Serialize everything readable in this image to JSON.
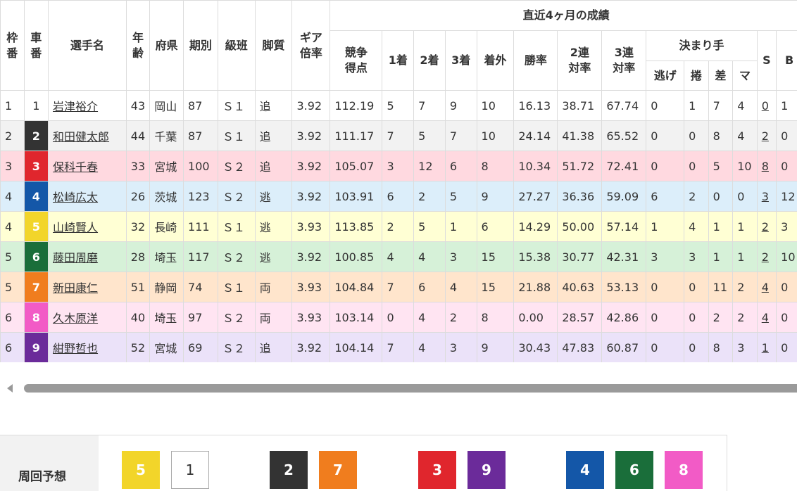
{
  "table": {
    "group_header": "直近4ヶ月の成績",
    "headers": {
      "waku": "枠\n番",
      "car": "車\n番",
      "name": "選手名",
      "age": "年\n齢",
      "pref": "府県",
      "term": "期別",
      "class": "級班",
      "style": "脚質",
      "gear": "ギア\n倍率",
      "score": "競争\n得点",
      "first": "1着",
      "second": "2着",
      "third": "3着",
      "out": "着外",
      "win_rate": "勝率",
      "rate2": "2連\n対率",
      "rate3": "3連\n対率",
      "kimarite": "決まり手",
      "nige": "逃げ",
      "makuri": "捲",
      "sashi": "差",
      "mark": "マ",
      "s": "S",
      "b": "B"
    },
    "rows": [
      {
        "waku": "1",
        "car": "1",
        "name": "岩津裕介",
        "age": "43",
        "pref": "岡山",
        "term": "87",
        "class": "Ｓ１",
        "style": "追",
        "gear": "3.92",
        "score": "112.19",
        "first": "5",
        "second": "7",
        "third": "9",
        "out": "10",
        "win_rate": "16.13",
        "rate2": "38.71",
        "rate3": "67.74",
        "nige": "0",
        "makuri": "1",
        "sashi": "7",
        "mark": "4",
        "s": "0",
        "b": "1",
        "car_color": "#ffffff",
        "row_class": "c0"
      },
      {
        "waku": "2",
        "car": "2",
        "name": "和田健太郎",
        "age": "44",
        "pref": "千葉",
        "term": "87",
        "class": "Ｓ１",
        "style": "追",
        "gear": "3.92",
        "score": "111.17",
        "first": "7",
        "second": "5",
        "third": "7",
        "out": "10",
        "win_rate": "24.14",
        "rate2": "41.38",
        "rate3": "65.52",
        "nige": "0",
        "makuri": "0",
        "sashi": "8",
        "mark": "4",
        "s": "2",
        "b": "0",
        "car_color": "#333333",
        "row_class": "c2"
      },
      {
        "waku": "3",
        "car": "3",
        "name": "保科千春",
        "age": "33",
        "pref": "宮城",
        "term": "100",
        "class": "Ｓ２",
        "style": "追",
        "gear": "3.92",
        "score": "105.07",
        "first": "3",
        "second": "12",
        "third": "6",
        "out": "8",
        "win_rate": "10.34",
        "rate2": "51.72",
        "rate3": "72.41",
        "nige": "0",
        "makuri": "0",
        "sashi": "5",
        "mark": "10",
        "s": "8",
        "b": "0",
        "car_color": "#e0262d",
        "row_class": "c3"
      },
      {
        "waku": "4",
        "car": "4",
        "name": "松崎広太",
        "age": "26",
        "pref": "茨城",
        "term": "123",
        "class": "Ｓ２",
        "style": "逃",
        "gear": "3.92",
        "score": "103.91",
        "first": "6",
        "second": "2",
        "third": "5",
        "out": "9",
        "win_rate": "27.27",
        "rate2": "36.36",
        "rate3": "59.09",
        "nige": "6",
        "makuri": "2",
        "sashi": "0",
        "mark": "0",
        "s": "3",
        "b": "12",
        "car_color": "#1457a8",
        "row_class": "c4"
      },
      {
        "waku": "4",
        "car": "5",
        "name": "山崎賢人",
        "age": "32",
        "pref": "長崎",
        "term": "111",
        "class": "Ｓ１",
        "style": "逃",
        "gear": "3.93",
        "score": "113.85",
        "first": "2",
        "second": "5",
        "third": "1",
        "out": "6",
        "win_rate": "14.29",
        "rate2": "50.00",
        "rate3": "57.14",
        "nige": "1",
        "makuri": "4",
        "sashi": "1",
        "mark": "1",
        "s": "2",
        "b": "3",
        "car_color": "#f2d52a",
        "row_class": "c5"
      },
      {
        "waku": "5",
        "car": "6",
        "name": "藤田周磨",
        "age": "28",
        "pref": "埼玉",
        "term": "117",
        "class": "Ｓ２",
        "style": "逃",
        "gear": "3.92",
        "score": "100.85",
        "first": "4",
        "second": "4",
        "third": "3",
        "out": "15",
        "win_rate": "15.38",
        "rate2": "30.77",
        "rate3": "42.31",
        "nige": "3",
        "makuri": "3",
        "sashi": "1",
        "mark": "1",
        "s": "2",
        "b": "10",
        "car_color": "#1a6e3a",
        "row_class": "c6"
      },
      {
        "waku": "5",
        "car": "7",
        "name": "新田康仁",
        "age": "51",
        "pref": "静岡",
        "term": "74",
        "class": "Ｓ１",
        "style": "両",
        "gear": "3.93",
        "score": "104.84",
        "first": "7",
        "second": "6",
        "third": "4",
        "out": "15",
        "win_rate": "21.88",
        "rate2": "40.63",
        "rate3": "53.13",
        "nige": "0",
        "makuri": "0",
        "sashi": "11",
        "mark": "2",
        "s": "4",
        "b": "0",
        "car_color": "#f07d1e",
        "row_class": "c7"
      },
      {
        "waku": "6",
        "car": "8",
        "name": "久木原洋",
        "age": "40",
        "pref": "埼玉",
        "term": "97",
        "class": "Ｓ２",
        "style": "両",
        "gear": "3.93",
        "score": "103.14",
        "first": "0",
        "second": "4",
        "third": "2",
        "out": "8",
        "win_rate": "0.00",
        "rate2": "28.57",
        "rate3": "42.86",
        "nige": "0",
        "makuri": "0",
        "sashi": "2",
        "mark": "2",
        "s": "4",
        "b": "0",
        "car_color": "#f25bc6",
        "row_class": "c8"
      },
      {
        "waku": "6",
        "car": "9",
        "name": "紺野哲也",
        "age": "52",
        "pref": "宮城",
        "term": "69",
        "class": "Ｓ２",
        "style": "追",
        "gear": "3.92",
        "score": "104.14",
        "first": "7",
        "second": "4",
        "third": "3",
        "out": "9",
        "win_rate": "30.43",
        "rate2": "47.83",
        "rate3": "60.87",
        "nige": "0",
        "makuri": "0",
        "sashi": "8",
        "mark": "3",
        "s": "1",
        "b": "0",
        "car_color": "#6b2b9a",
        "row_class": "c9"
      }
    ]
  },
  "prediction": {
    "label": "周回予想",
    "boxes": [
      {
        "num": "5",
        "color": "#f2d52a"
      },
      {
        "num": "1",
        "color": "#ffffff"
      },
      {
        "num": "2",
        "color": "#333333"
      },
      {
        "num": "7",
        "color": "#f07d1e"
      },
      {
        "num": "3",
        "color": "#e0262d"
      },
      {
        "num": "9",
        "color": "#6b2b9a"
      },
      {
        "num": "4",
        "color": "#1457a8"
      },
      {
        "num": "6",
        "color": "#1a6e3a"
      },
      {
        "num": "8",
        "color": "#f25bc6"
      }
    ]
  }
}
